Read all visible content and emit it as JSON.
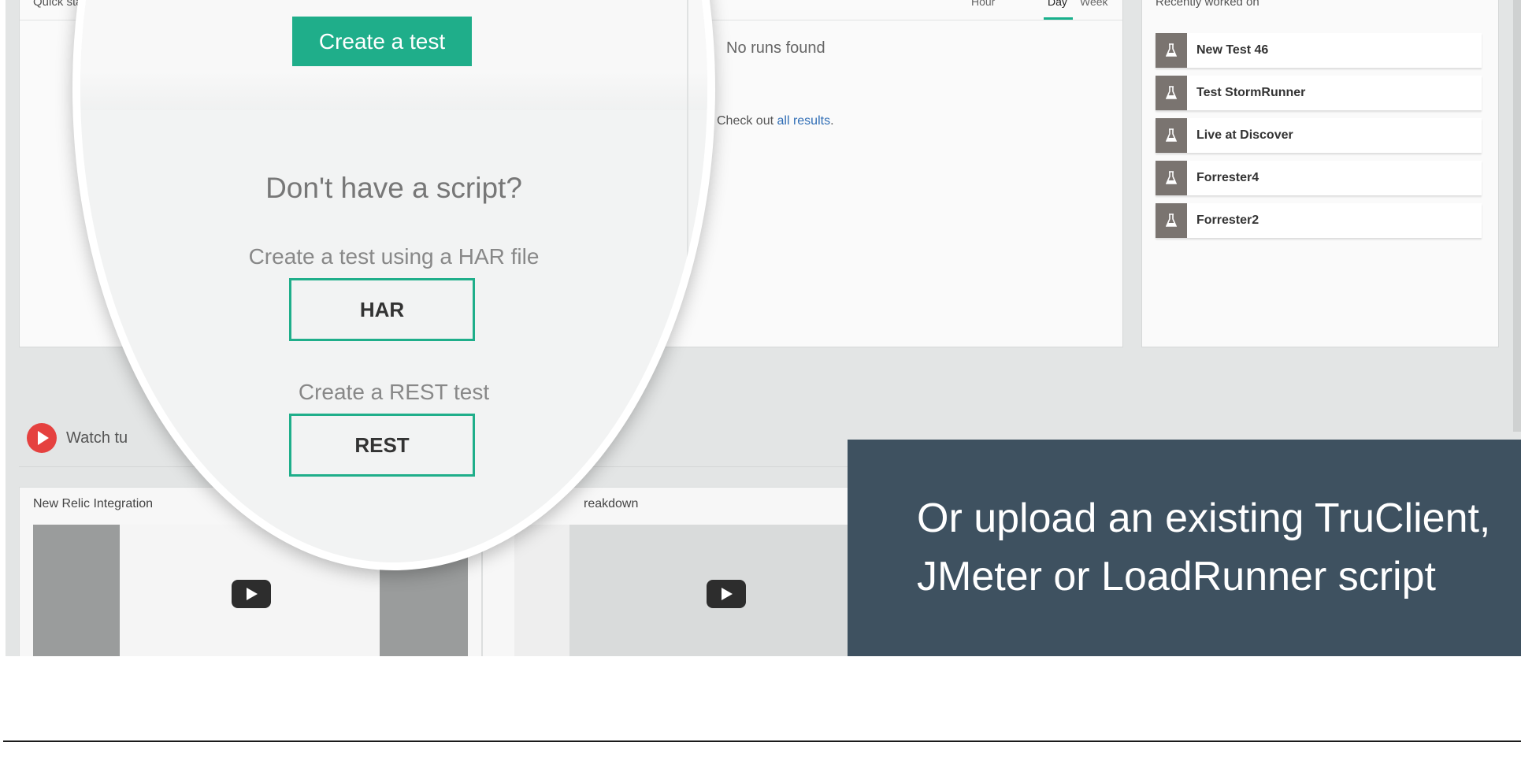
{
  "quick_start": {
    "title": "Quick start",
    "range_tabs": [
      "Hour",
      "Day",
      "Week"
    ],
    "active_range": "Day",
    "no_runs_text": "No runs found",
    "check_out_prefix": "Check out ",
    "check_out_link": "all results",
    "check_out_suffix": "."
  },
  "recent": {
    "title": "Recently worked on",
    "icon": "flask-icon",
    "items": [
      "New Test 46",
      "Test StormRunner",
      "Live at Discover",
      "Forrester4",
      "Forrester2"
    ]
  },
  "magnifier": {
    "create_test_label": "Create a test",
    "dont_have_script": "Don't have a script?",
    "har_caption": "Create a test using a HAR file",
    "har_label": "HAR",
    "rest_caption": "Create a REST test",
    "rest_label": "REST"
  },
  "tutorials": {
    "watch_label": "Watch tu",
    "cards": [
      "New Relic Integration",
      "reakdown"
    ]
  },
  "callout": {
    "line1": "Or upload an existing TruClient,",
    "line2": "JMeter or LoadRunner script"
  },
  "colors": {
    "accent_green": "#1fae8a",
    "callout_bg": "#3e5160",
    "play_red": "#e5413f",
    "link_blue": "#2f6db5"
  }
}
